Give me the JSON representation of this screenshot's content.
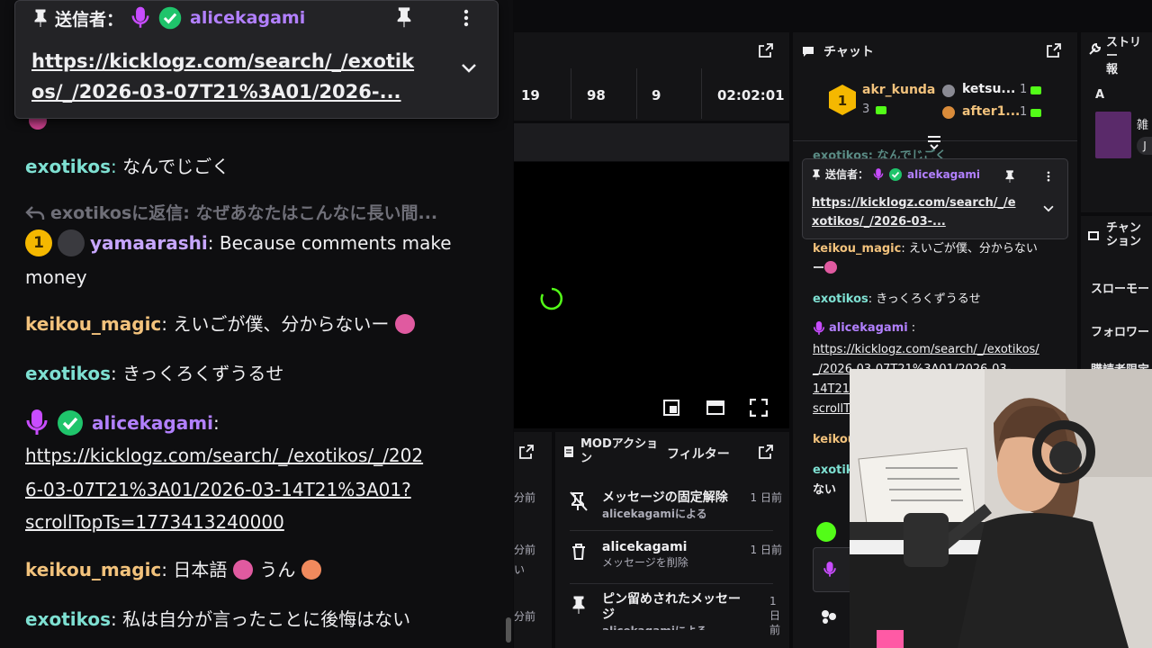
{
  "pinned_big": {
    "sender_label": "送信者：",
    "username": "alicekagami",
    "link_line1": "https://kicklogz.com/search/_/exotik",
    "link_line2": "os/_/2026-03-07T21%3A01/2026-..."
  },
  "left_chat": {
    "messages": [
      {
        "user": "exotikos",
        "sep": ": ",
        "text": "なんでじごく"
      },
      {
        "reply": "exotikosに返信: なぜあなたはこんなに長い間..."
      },
      {
        "badge": "1",
        "user": "yamaarashi",
        "sep": ": ",
        "text": "Because comments make",
        "text2": "money"
      },
      {
        "user": "keikou_magic",
        "sep": ": ",
        "text": "えいごが僕、分からないー"
      },
      {
        "user": "exotikos",
        "sep": ": ",
        "text": "きっくろくずうるせ"
      },
      {
        "user": "alicekagami",
        "sep": ":",
        "link1": "https://kicklogz.com/search/_/exotikos/_/202",
        "link2": "6-03-07T21%3A01/2026-03-14T21%3A01?",
        "link3": "scrollTopTs=1773413240000"
      },
      {
        "user": "keikou_magic",
        "sep": ": ",
        "text": "日本語",
        "text_b": "うん"
      },
      {
        "user": "exotikos",
        "sep": ": ",
        "text": "私は自分が言ったことに後悔はない"
      }
    ]
  },
  "stats": {
    "v1": "19",
    "v2": "98",
    "v3": "9",
    "uptime": "02:02:01"
  },
  "mod_panel": {
    "title": "MODアクション",
    "filter": "フィルター",
    "items": [
      {
        "title": "メッセージの固定解除",
        "sub": "alicekagamiによる",
        "time": "1 日前"
      },
      {
        "title": "alicekagami",
        "sub": "メッセージを削除",
        "time": "1 日前"
      },
      {
        "title": "ピン留めされたメッセージ",
        "sub": "alicekagamiによる",
        "time": "1 日前"
      }
    ]
  },
  "left_stub": {
    "times": [
      "分前",
      "分前",
      "い",
      "分前"
    ]
  },
  "right_chat": {
    "title": "チャット",
    "top_user": "akr_kunda",
    "top_count": "3",
    "u2": "ketsu...",
    "u2_count": "1",
    "u3": "after1...",
    "u3_count": "1",
    "faded": "exotikos: なんでじごく",
    "pinned_sender": "送信者：",
    "pinned_user": "alicekagami",
    "pinned_link1": "https://kicklogz.com/search/_/e",
    "pinned_link2": "xotikos/_/2026-03-...",
    "m1_user": "keikou_magic",
    "m1_text": "えいごが僕、分からない",
    "m1_text2": "ー",
    "m2_user": "exotikos",
    "m2_text": "きっくろくずうるせ",
    "m3_user": "alicekagami",
    "m3_link1": "https://kicklogz.com/search/_/exotikos/",
    "m3_link2": "_/2026-03-07T21%3A01/2026-03-",
    "m3_link3": "14T21",
    "m3_link4": "scrollT",
    "m4_user": "keikou",
    "m5_user": "exotik",
    "m5_text": "ない"
  },
  "far_right": {
    "title": "ストリー",
    "title2": "報",
    "item_a": "A",
    "item_text": "雑",
    "badge": "J",
    "section2": "チャン",
    "section2b": "ション",
    "row1": "スローモー",
    "row2": "フォロワー",
    "row3": "購読者限定"
  }
}
